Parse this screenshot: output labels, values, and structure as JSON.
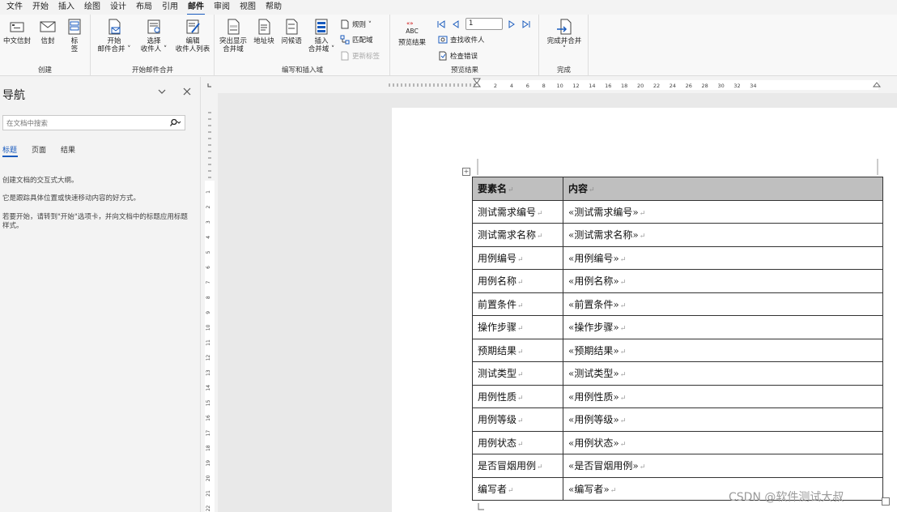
{
  "menu": {
    "tabs": [
      "文件",
      "开始",
      "插入",
      "绘图",
      "设计",
      "布局",
      "引用",
      "邮件",
      "审阅",
      "视图",
      "帮助"
    ],
    "active": "邮件"
  },
  "ribbon": {
    "create": {
      "label": "创建",
      "chinese_envelope": "中文信封",
      "envelope": "信封",
      "labels_line1": "标",
      "labels_line2": "签"
    },
    "start_merge": {
      "label": "开始邮件合并",
      "start_line1": "开始",
      "start_line2": "邮件合并 ˅",
      "select_line1": "选择",
      "select_line2": "收件人 ˅",
      "edit_line1": "编辑",
      "edit_line2": "收件人列表"
    },
    "write_insert": {
      "label": "编写和插入域",
      "highlight_line1": "突出显示",
      "highlight_line2": "合并域",
      "address_block": "地址块",
      "greeting": "问候语",
      "insert_line1": "插入",
      "insert_line2": "合并域 ˅",
      "rules": "规则 ˅",
      "match_fields": "匹配域",
      "update_labels": "更新标签"
    },
    "preview": {
      "label": "预览结果",
      "abc": "ABC",
      "preview_results": "预览结果",
      "record_value": "1",
      "find_recipient": "查找收件人",
      "check_errors": "检查错误"
    },
    "finish": {
      "label": "完成",
      "finish_line1": "完成并合并",
      "finish_line2": "˅"
    }
  },
  "nav": {
    "title": "导航",
    "search_placeholder": "在文档中搜索",
    "tabs": [
      "标题",
      "页面",
      "结果"
    ],
    "text1": "创建文档的交互式大纲。",
    "text2": "它是跟踪具体位置或快速移动内容的好方式。",
    "text3": "若要开始，请转到\"开始\"选项卡，并向文档中的标题应用标题样式。"
  },
  "ruler": {
    "labels": [
      "2",
      "4",
      "6",
      "8",
      "10",
      "12",
      "14",
      "16",
      "18",
      "20",
      "22",
      "24",
      "26",
      "28",
      "30",
      "32",
      "34"
    ],
    "vlabels": [
      "1",
      "2",
      "3",
      "4",
      "5",
      "6",
      "7",
      "8",
      "9",
      "10",
      "11",
      "12",
      "13",
      "14",
      "15",
      "16",
      "17",
      "18",
      "19",
      "20",
      "21",
      "22"
    ]
  },
  "table": {
    "headers": [
      "要素名",
      "内容"
    ],
    "rows": [
      [
        "测试需求编号",
        "«测试需求编号»"
      ],
      [
        "测试需求名称",
        "«测试需求名称»"
      ],
      [
        "用例编号",
        "«用例编号»"
      ],
      [
        "用例名称",
        "«用例名称»"
      ],
      [
        "前置条件",
        "«前置条件»"
      ],
      [
        "操作步骤",
        "«操作步骤»"
      ],
      [
        "预期结果",
        "«预期结果»"
      ],
      [
        "测试类型",
        "«测试类型»"
      ],
      [
        "用例性质",
        "«用例性质»"
      ],
      [
        "用例等级",
        "«用例等级»"
      ],
      [
        "用例状态",
        "«用例状态»"
      ],
      [
        "是否冒烟用例",
        "«是否冒烟用例»"
      ],
      [
        "编写者",
        "«编写者»"
      ]
    ],
    "paragraph_mark": "↵"
  },
  "watermark": "CSDN @软件测试大叔",
  "colors": {
    "accent": "#185abd",
    "header_fill": "#bfbfbf"
  }
}
